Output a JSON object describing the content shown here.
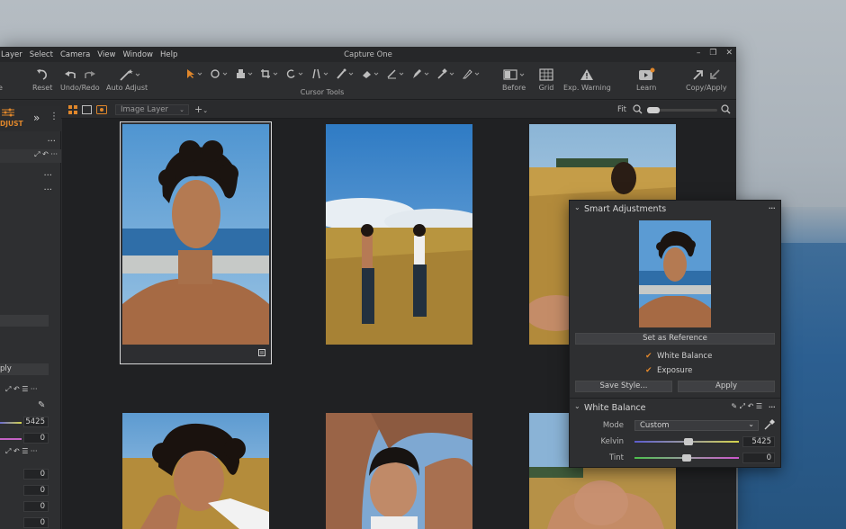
{
  "window": {
    "title": "Capture One",
    "menu": [
      "Layer",
      "Select",
      "Camera",
      "View",
      "Window",
      "Help"
    ]
  },
  "toolbar": {
    "left_items": [
      {
        "label": "e",
        "icon": "partial-icon"
      },
      {
        "label": "Reset",
        "icon": "reset-icon"
      },
      {
        "label": "Undo/Redo",
        "icon": "undo-redo-icon"
      },
      {
        "label": "Auto Adjust",
        "icon": "auto-adjust-icon"
      }
    ],
    "cursor_tools_label": "Cursor Tools",
    "right_items": [
      {
        "label": "Before",
        "icon": "before-icon"
      },
      {
        "label": "Grid",
        "icon": "grid-icon"
      },
      {
        "label": "Exp. Warning",
        "icon": "warning-icon"
      },
      {
        "label": "Learn",
        "icon": "learn-icon"
      },
      {
        "label": "Copy/Apply",
        "icon": "copy-apply-icon"
      }
    ]
  },
  "sidebar": {
    "tab_label": "DJUST",
    "value_a": "5425",
    "value_b": "0",
    "zeros": [
      "0",
      "0",
      "0",
      "0"
    ],
    "apply_fragment": "ply"
  },
  "subbar": {
    "layer_select": "Image Layer",
    "fit_label": "Fit"
  },
  "smart_adjustments": {
    "title": "Smart Adjustments",
    "set_reference": "Set as Reference",
    "white_balance_check": "White Balance",
    "exposure_check": "Exposure",
    "save_style": "Save Style...",
    "apply": "Apply"
  },
  "white_balance": {
    "title": "White Balance",
    "mode_label": "Mode",
    "mode_value": "Custom",
    "kelvin_label": "Kelvin",
    "kelvin_value": "5425",
    "kelvin_level": 0.52,
    "tint_label": "Tint",
    "tint_value": "0",
    "tint_level": 0.5
  },
  "colors": {
    "accent": "#e0872b",
    "panel": "#2e2f31",
    "browser_bg": "#202123"
  }
}
